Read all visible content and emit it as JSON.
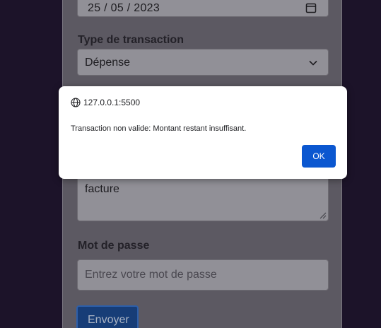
{
  "form": {
    "date_value": "25 / 05 / 2023",
    "transaction_type_label": "Type de transaction",
    "transaction_type_value": "Dépense",
    "description_value": "facture",
    "password_label": "Mot de passe",
    "password_placeholder": "Entrez votre mot de passe",
    "submit_label": "Envoyer"
  },
  "dialog": {
    "origin": "127.0.0.1:5500",
    "message": "Transaction non valide: Montant restant insuffisant.",
    "ok_label": "OK"
  },
  "colors": {
    "page_background": "#1c1329",
    "dialog_button": "#0b57d0",
    "submit_button": "#173d77"
  },
  "icons": {
    "date": "calendar-icon",
    "select": "chevron-down-icon",
    "origin": "globe-icon",
    "textarea": "resize-grip-icon"
  }
}
